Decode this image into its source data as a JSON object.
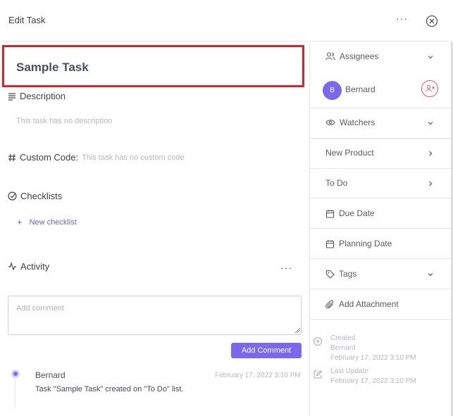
{
  "header": {
    "title": "Edit Task",
    "more_label": "···"
  },
  "task": {
    "name": "Sample Task"
  },
  "description": {
    "label": "Description",
    "placeholder": "This task has no description"
  },
  "custom_code": {
    "label": "Custom Code:",
    "placeholder": "This task has no custom code"
  },
  "checklists": {
    "label": "Checklists",
    "new_label": "New checklist"
  },
  "activity": {
    "label": "Activity",
    "more_label": "···",
    "comment_placeholder": "Add comment",
    "add_comment_label": "Add Comment",
    "entries": [
      {
        "author": "Bernard",
        "time": "February 17, 2022 3:10 PM",
        "text": "Task \"Sample Task\" created on \"To Do\" list."
      }
    ]
  },
  "sidebar": {
    "assignees_label": "Assignees",
    "assignee": {
      "initial": "B",
      "name": "Bernard"
    },
    "watchers_label": "Watchers",
    "project_label": "New Product",
    "status_label": "To Do",
    "due_date_label": "Due Date",
    "planning_date_label": "Planning Date",
    "tags_label": "Tags",
    "attachment_label": "Add Attachment",
    "created": {
      "label": "Created",
      "by": "Bernard",
      "time": "February 17, 2022 3:10 PM"
    },
    "updated": {
      "label": "Last Update",
      "time": "February 17, 2022 3:10 PM"
    }
  },
  "colors": {
    "accent": "#7b68ee",
    "highlight_border": "#d5252c",
    "remove": "#e05a5a"
  },
  "icons": {
    "close": "close-circle-icon",
    "description": "align-left-icon",
    "custom_code": "hash-icon",
    "checklists": "check-circle-icon",
    "activity": "activity-icon",
    "assignees": "users-icon",
    "watchers": "eye-icon",
    "due_date": "calendar-icon",
    "planning_date": "calendar-icon",
    "tags": "tag-icon",
    "attachment": "paperclip-icon",
    "created": "plus-circle-icon",
    "updated": "edit-icon"
  }
}
